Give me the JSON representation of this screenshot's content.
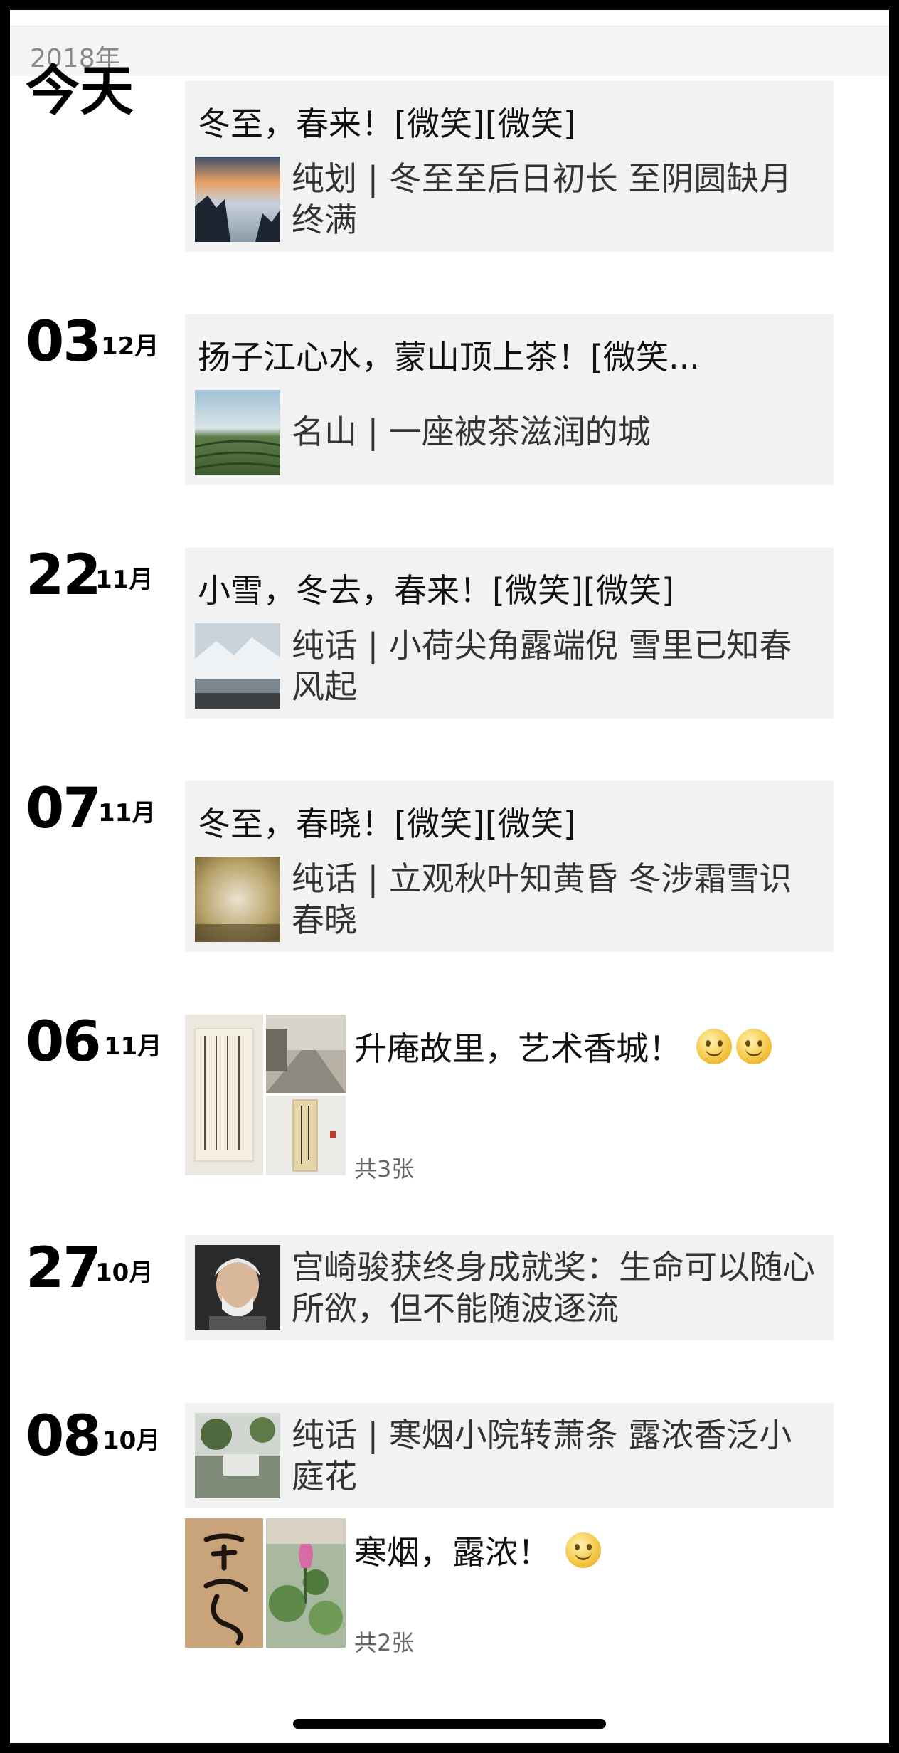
{
  "year": "2018年",
  "posts": [
    {
      "date_label": "今天",
      "card_title": "冬至，春来！[微笑][微笑]",
      "card_subtitle": "纯划 | 冬至至后日初长   至阴圆缺月终满",
      "thumb_icon": "sunrise-mountain-thumbnail"
    },
    {
      "day": "03",
      "month": "12月",
      "card_title": "扬子江心水，蒙山顶上茶！[微笑...",
      "card_subtitle": "名山  |  一座被茶滋润的城",
      "thumb_icon": "tea-field-thumbnail"
    },
    {
      "day": "22",
      "month": "11月",
      "card_title": "小雪，冬去，春来！[微笑][微笑]",
      "card_subtitle": "纯话 | 小荷尖角露端倪 雪里已知春风起",
      "thumb_icon": "snow-mountain-thumbnail"
    },
    {
      "day": "07",
      "month": "11月",
      "card_title": "冬至，春晓！[微笑][微笑]",
      "card_subtitle": "纯话 | 立观秋叶知黄昏  冬涉霜雪识春晓",
      "thumb_icon": "misty-autumn-thumbnail"
    },
    {
      "day": "06",
      "month": "11月",
      "text": "升庵故里，艺术香城！",
      "photo_count": "共3张"
    },
    {
      "day": "27",
      "month": "10月",
      "card_subtitle": "宫崎骏获终身成就奖：生命可以随心所欲，但不能随波逐流",
      "thumb_icon": "portrait-thumbnail"
    },
    {
      "day": "08",
      "month": "10月",
      "card_subtitle": "纯话 | 寒烟小院转萧条   露浓香泛小庭花",
      "thumb_icon": "courtyard-thumbnail",
      "text": "寒烟，露浓！",
      "photo_count": "共2张"
    }
  ],
  "colors": {
    "background": "#ffffff",
    "card": "#f2f2f3",
    "year_bar": "#f4f4f4"
  }
}
